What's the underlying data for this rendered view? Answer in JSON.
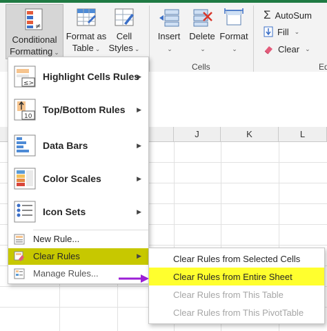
{
  "ribbon": {
    "buttons": [
      {
        "line1": "Conditional",
        "line2": "Formatting"
      },
      {
        "line1": "Format as",
        "line2": "Table"
      },
      {
        "line1": "Cell",
        "line2": "Styles"
      },
      {
        "line1": "Insert"
      },
      {
        "line1": "Delete"
      },
      {
        "line1": "Format"
      }
    ],
    "cells_group_label": "Cells",
    "editing_group_label_partial": "Ed",
    "autosum_label": "AutoSum",
    "fill_label": "Fill",
    "clear_label": "Clear"
  },
  "sheet": {
    "columns": [
      "J",
      "K",
      "L"
    ]
  },
  "cf_menu": {
    "items": [
      {
        "label": "Highlight Cells Rules",
        "icon": "highlight-cells-icon"
      },
      {
        "label": "Top/Bottom Rules",
        "icon": "top-bottom-icon"
      },
      {
        "label": "Data Bars",
        "icon": "data-bars-icon"
      },
      {
        "label": "Color Scales",
        "icon": "color-scales-icon"
      },
      {
        "label": "Icon Sets",
        "icon": "icon-sets-icon"
      }
    ],
    "new_rule": "New Rule...",
    "clear_rules": "Clear Rules",
    "manage_rules": "Manage Rules..."
  },
  "submenu": {
    "items": [
      {
        "label": "Clear Rules from Selected Cells",
        "enabled": true
      },
      {
        "label": "Clear Rules from Entire Sheet",
        "enabled": true
      },
      {
        "label": "Clear Rules from This Table",
        "enabled": false
      },
      {
        "label": "Clear Rules from This PivotTable",
        "enabled": false
      }
    ]
  },
  "colors": {
    "highlight_yellow": "#ffff2e",
    "clear_rules_highlight": "#c7c800",
    "arrow_purple": "#9b1fd6",
    "excel_green": "#1f7a43"
  }
}
